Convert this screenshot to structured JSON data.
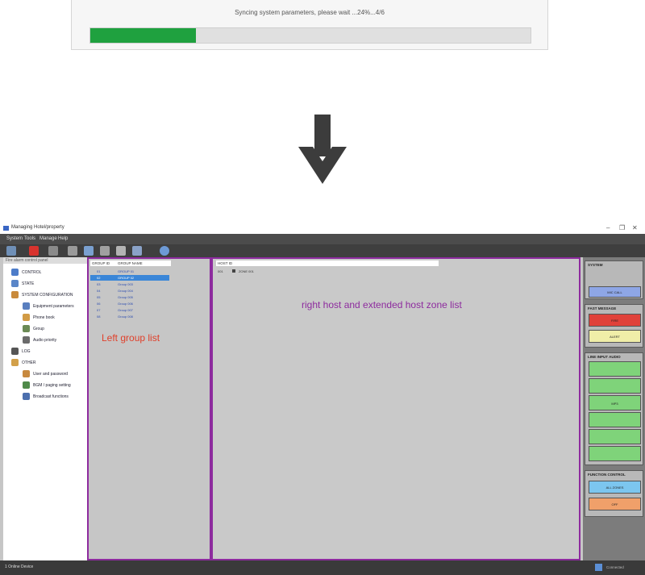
{
  "sync_dialog": {
    "message": "Syncing system parameters, please wait ...24%...4/6",
    "progress": 0.24,
    "fill_color": "#1fa13f"
  },
  "arrow": {
    "icon": "down-arrow-icon"
  },
  "app": {
    "title": "Managing Hotel/property",
    "menu": [
      "System",
      "Tools",
      "Manage",
      "Help"
    ],
    "window_controls": [
      "–",
      "❐",
      "✕"
    ],
    "tree_header": "Fire alarm control panel",
    "tree_items": [
      {
        "label": "CONTROL",
        "icon": "control-icon",
        "level": 0
      },
      {
        "label": "STATE",
        "icon": "state-icon",
        "level": 0
      },
      {
        "label": "SYSTEM CONFIGURATION",
        "icon": "config-icon",
        "level": 0
      },
      {
        "label": "Equipment parameters",
        "icon": "equipment-icon",
        "level": 1
      },
      {
        "label": "Phone book",
        "icon": "phonebook-icon",
        "level": 1
      },
      {
        "label": "Group",
        "icon": "group-icon",
        "level": 1
      },
      {
        "label": "Audio priority",
        "icon": "audio-icon",
        "level": 1
      },
      {
        "label": "LOG",
        "icon": "log-icon",
        "level": 0
      },
      {
        "label": "OTHER",
        "icon": "other-icon",
        "level": 0
      },
      {
        "label": "User and password",
        "icon": "user-icon",
        "level": 1
      },
      {
        "label": "BGM / paging setting",
        "icon": "bgm-icon",
        "level": 1
      },
      {
        "label": "Broadcast functions",
        "icon": "broadcast-icon",
        "level": 1
      }
    ],
    "group_list": {
      "headers": [
        "GROUP ID",
        "GROUP NAME"
      ],
      "rows": [
        [
          "01",
          "GROUP 01"
        ],
        [
          "02",
          "GROUP 02"
        ],
        [
          "03",
          "Group 003"
        ],
        [
          "04",
          "Group 004"
        ],
        [
          "05",
          "Group 005"
        ],
        [
          "06",
          "Group 006"
        ],
        [
          "07",
          "Group 007"
        ],
        [
          "08",
          "Group 008"
        ]
      ],
      "selected_index": 1,
      "annotation": "Left group list"
    },
    "zone_panel": {
      "header": "HOST ID",
      "row": [
        "001",
        "ZONE 001"
      ],
      "annotation": "right host and extended host zone list"
    },
    "right_sidebar": {
      "sections": [
        {
          "title": "SYSTEM",
          "buttons": [
            {
              "label": "",
              "color": "#b8b8b8"
            },
            {
              "label": "",
              "color": "#b8b8b8"
            },
            {
              "label": "MIC CALL",
              "color": "#8ea6e6"
            }
          ]
        },
        {
          "title": "FAST MESSAGE",
          "buttons": [
            {
              "label": "FIRE",
              "color": "#e0413a"
            },
            {
              "label": "ALERT",
              "color": "#f0eea8"
            }
          ]
        },
        {
          "title": "LINE INPUT AUDIO",
          "buttons": [
            {
              "label": "",
              "color": "#7fd37a"
            },
            {
              "label": "",
              "color": "#7fd37a"
            },
            {
              "label": "MP3",
              "color": "#7fd37a"
            },
            {
              "label": "",
              "color": "#7fd37a"
            },
            {
              "label": "",
              "color": "#7fd37a"
            },
            {
              "label": "",
              "color": "#7fd37a"
            }
          ]
        },
        {
          "title": "FUNCTION CONTROL",
          "buttons": [
            {
              "label": "ALL ZONES",
              "color": "#7cc6ef"
            },
            {
              "label": "OFF",
              "color": "#f0a06a"
            }
          ]
        }
      ]
    },
    "statusbar": {
      "left": "1 Online Device",
      "right": "Connected"
    }
  }
}
